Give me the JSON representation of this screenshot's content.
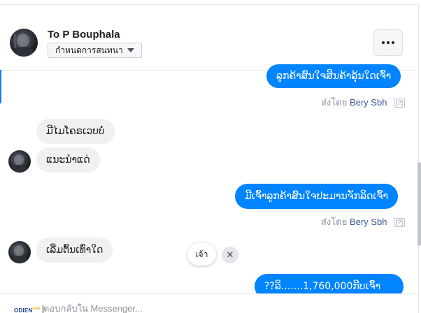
{
  "header": {
    "name": "To P Bouphala",
    "status_label": "กำหนดการสนทนา",
    "more_icon": "more-horizontal-icon"
  },
  "messages": [
    {
      "side": "out",
      "text": "ລູກຄ້າສົນໃຈສິນຄ້າລຸ້ນໃດເຈົ້າ"
    },
    {
      "side": "in",
      "text": "ມີໄມໂຄຣເວບບໍ່"
    },
    {
      "side": "in",
      "text": "ແນະນຳແດ່"
    },
    {
      "side": "out",
      "text": "ມີເຈົ້າລູກຄ້າສົນໃຈປະມານຈັກລິດເຈົ້າ"
    },
    {
      "side": "in",
      "text": "ເລີ່ມຕົ້ນເທົ່າໃດ"
    },
    {
      "side": "out",
      "text": "??ລິ.......1,760,000ກີບເຈົ້າ"
    }
  ],
  "sent_by": {
    "prefix": "ส่งโดย",
    "name": "Bery Sbh",
    "help": "[?]"
  },
  "quick_reply": {
    "label": "เจ้า",
    "dismiss": "✕"
  },
  "composer": {
    "placeholder": "ตอบกลับใน Messenger...",
    "brand_name": "ODIEN",
    "brand_sup": "mall"
  },
  "colors": {
    "outgoing_bubble": "#0084ff",
    "incoming_bubble": "#f1f0f0",
    "sender_link": "#385898"
  }
}
